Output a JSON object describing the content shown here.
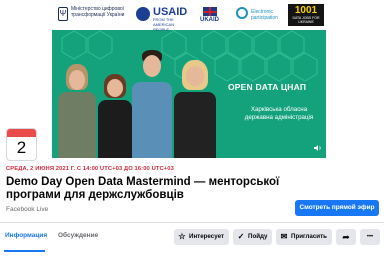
{
  "cover": {
    "logos": {
      "ministry": "Міністерство цифрової трансформації України",
      "ministry_emblem": "trident-icon",
      "usaid": "USAID",
      "usaid_sub": "FROM THE AMERICAN PEOPLE",
      "ukaid": "UKAID",
      "eparticipation": "Electronic participation",
      "d1001_number": "1001",
      "d1001_sub": "DATA JOBS FOR UKRAINE"
    },
    "title": "OPEN DATA ЦНАП",
    "subtitle": "Харківська обласна державна адміністрація",
    "colors": {
      "background": "#14a27c",
      "hex_pattern": "#2fbf95"
    }
  },
  "event": {
    "month_color": "#e94b4b",
    "day": "2",
    "date_line": "СРЕДА, 2 ИЮНЯ 2021 Г. С 14:00 UTC+03 ДО 16:00 UTC+03",
    "title": "Demo Day Open Data Mastermind — менторської програми для держслужбовців",
    "source": "Facebook Live",
    "live_button": "Смотреть прямой эфир"
  },
  "tabs": [
    {
      "label": "Информация",
      "active": true
    },
    {
      "label": "Обсуждение",
      "active": false
    }
  ],
  "actions": {
    "interested": {
      "label": "Интересует",
      "icon": "star-icon"
    },
    "going": {
      "label": "Пойду",
      "icon": "check-circle-icon"
    },
    "invite": {
      "label": "Пригласить",
      "icon": "envelope-icon"
    },
    "share": {
      "icon": "share-arrow-icon",
      "glyph": "➦"
    },
    "more": {
      "icon": "more-dots-icon",
      "glyph": "•••"
    }
  },
  "theme": {
    "accent": "#1877f2",
    "text": "#050505",
    "muted": "#65676b",
    "date_red": "#d2293a"
  }
}
